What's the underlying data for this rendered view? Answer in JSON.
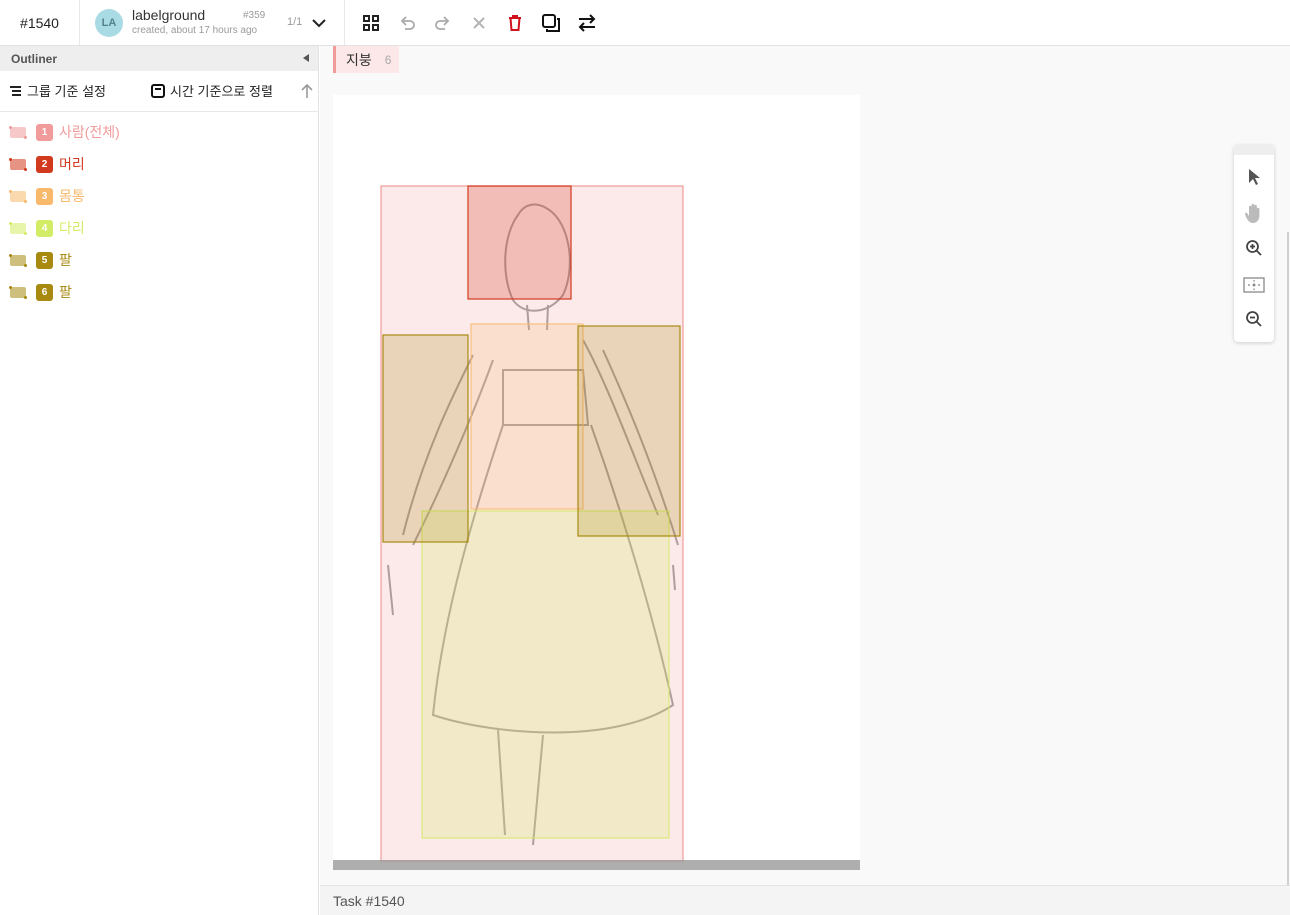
{
  "topbar": {
    "task_id": "#1540",
    "user": {
      "avatar_initials": "LA",
      "name": "labelground",
      "subtitle": "created, about 17 hours ago",
      "number": "#359"
    },
    "page_count": "1/1",
    "tools": [
      "grid-icon",
      "undo-icon",
      "redo-icon",
      "close-icon",
      "trash-icon",
      "copy-icon",
      "swap-icon"
    ]
  },
  "sidebar": {
    "title": "Outliner",
    "group_label": "그룹 기준 설정",
    "time_sort_label": "시간 기준으로 정렬",
    "items": [
      {
        "num": "1",
        "label": "사람(전체)",
        "color": "#f19b9b"
      },
      {
        "num": "2",
        "label": "머리",
        "color": "#d13a1e"
      },
      {
        "num": "3",
        "label": "몸통",
        "color": "#f8b96c"
      },
      {
        "num": "4",
        "label": "다리",
        "color": "#d3ec66"
      },
      {
        "num": "5",
        "label": "팔",
        "color": "#a88a10"
      },
      {
        "num": "6",
        "label": "팔",
        "color": "#a88a10"
      }
    ]
  },
  "main": {
    "tag_label": "지붕",
    "tag_count": "6",
    "footer": "Task #1540"
  },
  "zoom_tools": [
    "pointer-icon",
    "hand-icon",
    "zoom-in-icon",
    "fit-icon",
    "zoom-out-icon"
  ]
}
